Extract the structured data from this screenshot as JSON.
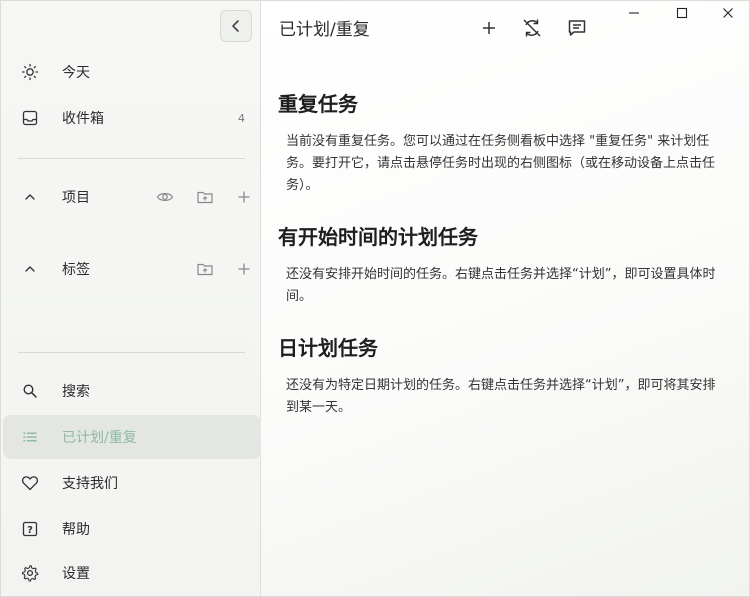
{
  "sidebar": {
    "nav_top": [
      {
        "label": "今天",
        "icon": "sun-icon"
      },
      {
        "label": "收件箱",
        "icon": "inbox-icon",
        "count": "4"
      }
    ],
    "projects": {
      "label": "项目"
    },
    "tags": {
      "label": "标签"
    },
    "nav_bottom": [
      {
        "label": "搜索",
        "icon": "search-icon"
      },
      {
        "label": "已计划/重复",
        "icon": "list-icon",
        "active": true
      },
      {
        "label": "支持我们",
        "icon": "heart-icon"
      },
      {
        "label": "帮助",
        "icon": "help-icon"
      },
      {
        "label": "设置",
        "icon": "gear-icon"
      }
    ]
  },
  "main": {
    "title": "已计划/重复",
    "sections": [
      {
        "title": "重复任务",
        "text": "当前没有重复任务。您可以通过在任务侧看板中选择 \"重复任务\" 来计划任务。要打开它，请点击悬停任务时出现的右侧图标（或在移动设备上点击任务）。"
      },
      {
        "title": "有开始时间的计划任务",
        "text": "还没有安排开始时间的任务。右键点击任务并选择“计划”，即可设置具体时间。"
      },
      {
        "title": "日计划任务",
        "text": "还没有为特定日期计划的任务。右键点击任务并选择“计划”，即可将其安排到某一天。"
      }
    ]
  },
  "colors": {
    "accent": "#8fb9a6",
    "active_bg": "#e3e6e2",
    "sidebar_bg": "#f4f5f3"
  }
}
